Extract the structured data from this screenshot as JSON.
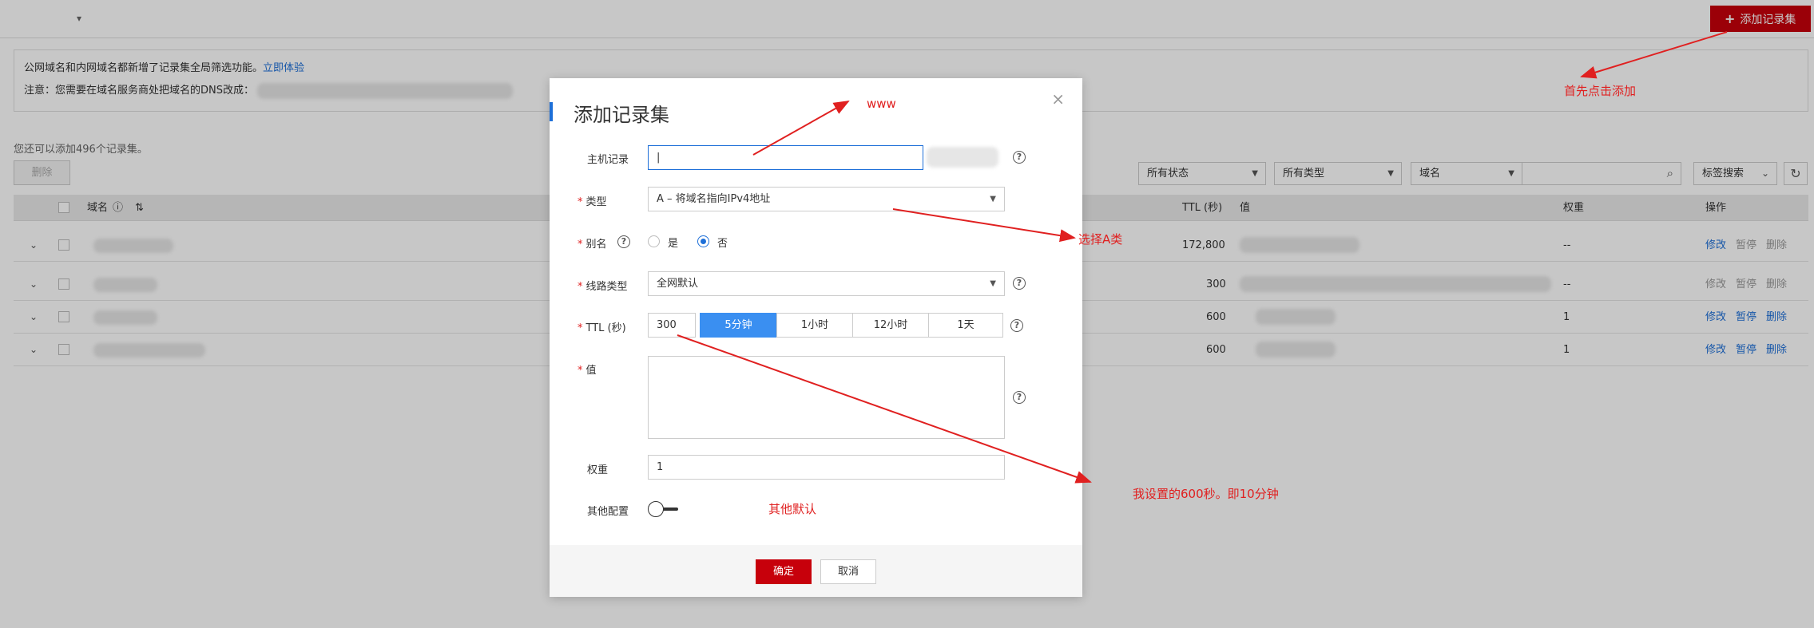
{
  "topbar": {
    "caret": "▾",
    "add_button_label": "添加记录集"
  },
  "notice": {
    "line1": "公网域名和内网域名都新增了记录集全局筛选功能。",
    "line1_link": "立即体验",
    "line2": "注意：您需要在域名服务商处把域名的DNS改成："
  },
  "quota_text": "您还可以添加496个记录集。",
  "delete_button": "删除",
  "filters": {
    "status": "所有状态",
    "type": "所有类型",
    "field": "域名",
    "tag_search": "标签搜索"
  },
  "table": {
    "headers": {
      "domain": "域名",
      "ttl": "TTL (秒)",
      "value": "值",
      "weight": "权重",
      "action": "操作"
    },
    "rows": [
      {
        "ttl": "172,800",
        "weight": "--",
        "actions": [
          "修改",
          "暂停",
          "删除"
        ],
        "enabled": true
      },
      {
        "ttl": "300",
        "weight": "--",
        "actions": [
          "修改",
          "暂停",
          "删除"
        ],
        "enabled": false
      },
      {
        "ttl": "600",
        "weight": "1",
        "actions": [
          "修改",
          "暂停",
          "删除"
        ],
        "enabled": true
      },
      {
        "ttl": "600",
        "weight": "1",
        "actions": [
          "修改",
          "暂停",
          "删除"
        ],
        "enabled": true
      }
    ]
  },
  "dialog": {
    "title": "添加记录集",
    "close": "×",
    "host_label": "主机记录",
    "host_value": "|",
    "type_label": "类型",
    "type_value": "A – 将域名指向IPv4地址",
    "alias_label": "别名",
    "alias_yes": "是",
    "alias_no": "否",
    "alias_selected": "否",
    "line_label": "线路类型",
    "line_value": "全网默认",
    "ttl_label": "TTL (秒)",
    "ttl_value": "300",
    "ttl_options": [
      "5分钟",
      "1小时",
      "12小时",
      "1天"
    ],
    "ttl_selected": "5分钟",
    "value_label": "值",
    "weight_label": "权重",
    "weight_value": "1",
    "other_label": "其他配置",
    "ok": "确定",
    "cancel": "取消"
  },
  "annotations": {
    "www": "www",
    "select_a": "选择A类",
    "ttl_note": "我设置的600秒。即10分钟",
    "other_default": "其他默认",
    "first_add": "首先点击添加"
  },
  "colors": {
    "brand_red": "#c7000b",
    "link_blue": "#1d6fd8",
    "annotation_red": "#e02020",
    "selected_blue": "#3a8ff1"
  }
}
